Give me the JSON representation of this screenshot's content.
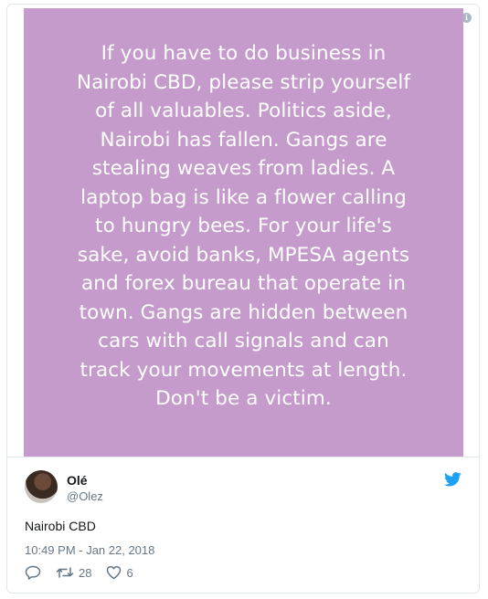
{
  "tweet": {
    "image_text": "If you have to do business in\nNairobi CBD, please strip yourself\nof all valuables. Politics aside,\nNairobi has fallen. Gangs are\nstealing weaves from ladies. A\nlaptop bag is like a flower calling\nto hungry bees. For your life's\nsake, avoid banks, MPESA agents\nand forex bureau that operate in\ntown. Gangs are hidden between\ncars with call signals and can\ntrack your movements at length.\nDon't be a victim.",
    "image_bg_color": "#c49bcb",
    "author": {
      "name": "Olé",
      "handle": "@Olez"
    },
    "text": "Nairobi CBD",
    "timestamp": "10:49 PM - Jan 22, 2018",
    "actions": {
      "reply_icon": "reply-icon",
      "retweet_icon": "retweet-icon",
      "retweet_count": "28",
      "like_icon": "heart-icon",
      "like_count": "6"
    },
    "brand_icon": "twitter-bird-icon",
    "brand_color": "#1da1f2",
    "info_icon": "info-icon"
  }
}
